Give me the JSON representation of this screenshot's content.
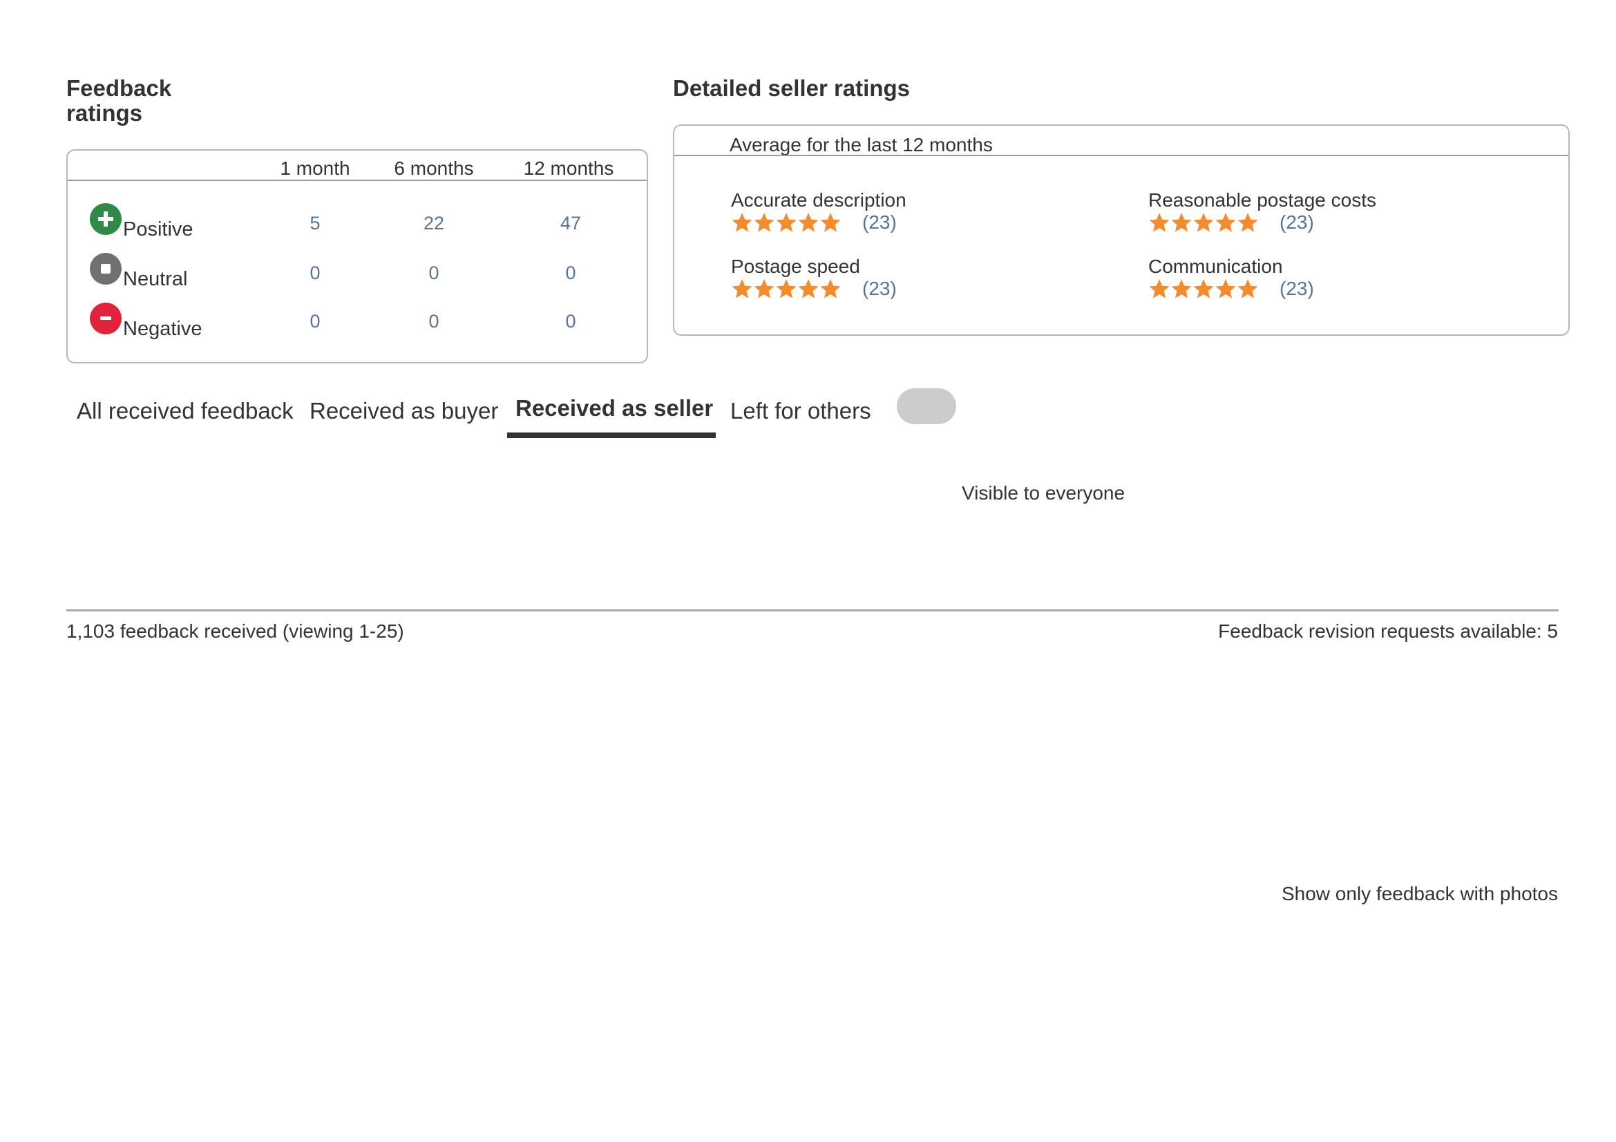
{
  "feedback_ratings": {
    "title_line1": "Feedback",
    "title_line2": "ratings",
    "columns": [
      "1 month",
      "6 months",
      "12 months"
    ],
    "rows": [
      {
        "label": "Positive",
        "icon": "plus-circle-icon",
        "color": "#2f8a47",
        "values": [
          "5",
          "22",
          "47"
        ]
      },
      {
        "label": "Neutral",
        "icon": "square-circle-icon",
        "color": "#707070",
        "values": [
          "0",
          "0",
          "0"
        ]
      },
      {
        "label": "Negative",
        "icon": "minus-circle-icon",
        "color": "#e0233b",
        "values": [
          "0",
          "0",
          "0"
        ]
      }
    ]
  },
  "detailed_ratings": {
    "title": "Detailed seller ratings",
    "subtitle": "Average for the last 12 months",
    "star_color": "#f18d2e",
    "items": [
      {
        "label": "Accurate description",
        "stars": 5,
        "count": "(23)"
      },
      {
        "label": "Reasonable postage costs",
        "stars": 5,
        "count": "(23)"
      },
      {
        "label": "Postage speed",
        "stars": 5,
        "count": "(23)"
      },
      {
        "label": "Communication",
        "stars": 5,
        "count": "(23)"
      }
    ]
  },
  "tabs": [
    {
      "label": "All received feedback",
      "active": false
    },
    {
      "label": "Received as buyer",
      "active": false
    },
    {
      "label": "Received as seller",
      "active": true
    },
    {
      "label": "Left for others",
      "active": false
    }
  ],
  "visibility_text": "Visible to everyone",
  "summary": {
    "feedback_count": "1,103 feedback received (viewing 1-25)",
    "revision_requests": "Feedback revision requests available: 5"
  },
  "filter": {
    "photos_only_label": "Show only feedback with photos"
  }
}
